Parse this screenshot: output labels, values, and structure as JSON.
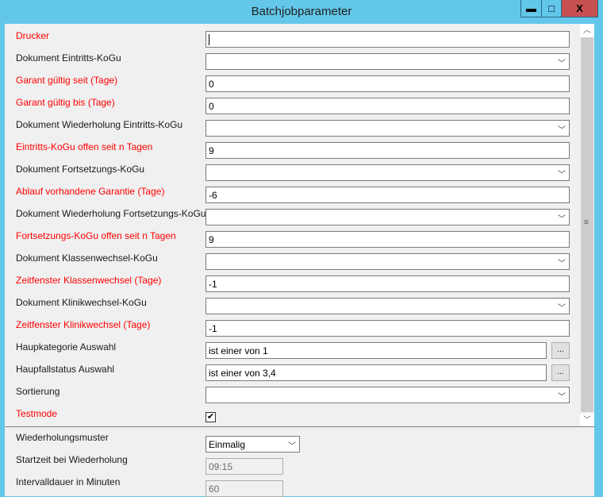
{
  "window": {
    "title": "Batchjobparameter",
    "minimize": "▬",
    "maximize": "□",
    "close": "X"
  },
  "params": [
    {
      "label": "Drucker",
      "required": true,
      "type": "text",
      "value": ""
    },
    {
      "label": "Dokument Eintritts-KoGu",
      "required": false,
      "type": "select",
      "value": ""
    },
    {
      "label": "Garant gültig seit (Tage)",
      "required": true,
      "type": "text",
      "value": "0"
    },
    {
      "label": "Garant gültig bis (Tage)",
      "required": true,
      "type": "text",
      "value": "0"
    },
    {
      "label": "Dokument Wiederholung Eintritts-KoGu",
      "required": false,
      "type": "select",
      "value": ""
    },
    {
      "label": "Eintritts-KoGu offen seit n Tagen",
      "required": true,
      "type": "text",
      "value": "9"
    },
    {
      "label": "Dokument Fortsetzungs-KoGu",
      "required": false,
      "type": "select",
      "value": ""
    },
    {
      "label": "Ablauf vorhandene Garantie (Tage)",
      "required": true,
      "type": "text",
      "value": "-6"
    },
    {
      "label": "Dokument Wiederholung Fortsetzungs-KoGu",
      "required": false,
      "type": "select",
      "value": ""
    },
    {
      "label": "Fortsetzungs-KoGu offen seit n Tagen",
      "required": true,
      "type": "text",
      "value": "9"
    },
    {
      "label": "Dokument Klassenwechsel-KoGu",
      "required": false,
      "type": "select",
      "value": ""
    },
    {
      "label": "Zeitfenster Klassenwechsel (Tage)",
      "required": true,
      "type": "text",
      "value": "-1"
    },
    {
      "label": "Dokument Klinikwechsel-KoGu",
      "required": false,
      "type": "select",
      "value": ""
    },
    {
      "label": "Zeitfenster Klinikwechsel (Tage)",
      "required": true,
      "type": "text",
      "value": "-1"
    },
    {
      "label": "Haupkategorie Auswahl",
      "required": false,
      "type": "picker",
      "value": "ist einer von 1",
      "button": "..."
    },
    {
      "label": "Haupfallstatus Auswahl",
      "required": false,
      "type": "picker",
      "value": "ist einer von 3,4",
      "button": "..."
    },
    {
      "label": "Sortierung",
      "required": false,
      "type": "select",
      "value": ""
    },
    {
      "label": "Testmode",
      "required": true,
      "type": "checkbox",
      "checked": true
    }
  ],
  "schedule": {
    "pattern_label": "Wiederholungsmuster",
    "pattern_value": "Einmalig",
    "start_label": "Startzeit bei Wiederholung",
    "start_value": "09:15",
    "interval_label": "Intervalldauer in Minuten",
    "interval_value": "60"
  }
}
